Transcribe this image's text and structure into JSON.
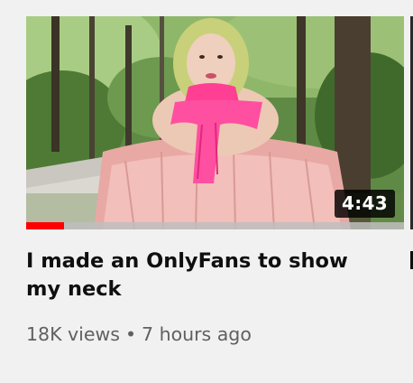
{
  "video": {
    "title": "I made an OnlyFans to show my neck",
    "duration": "4:43",
    "views": "18K views",
    "separator": "•",
    "uploaded": "7 hours ago",
    "watch_progress": 0.1
  },
  "colors": {
    "background": "#f1f1f1",
    "progress": "#ff0000",
    "title": "#0f0f0f",
    "meta": "#606060"
  }
}
